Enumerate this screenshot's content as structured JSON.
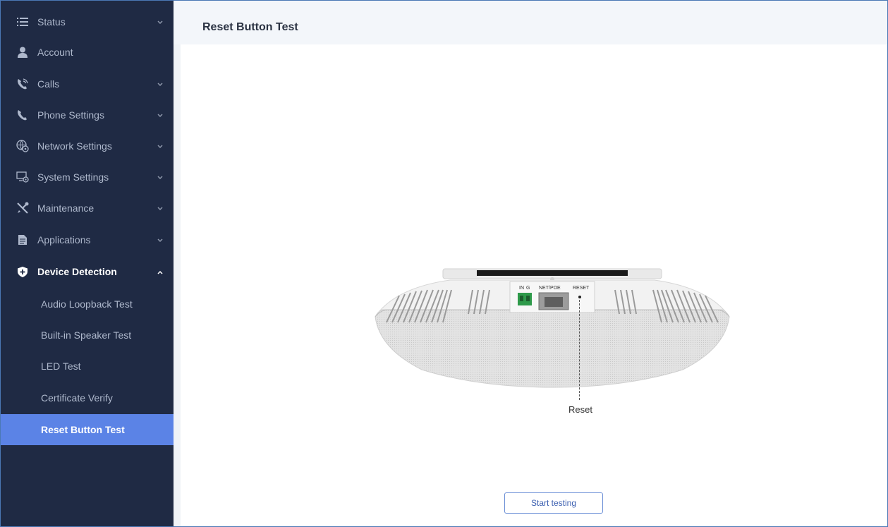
{
  "sidebar": {
    "items": [
      {
        "label": "Status",
        "icon": "list-icon",
        "expandable": true
      },
      {
        "label": "Account",
        "icon": "user-icon",
        "expandable": false
      },
      {
        "label": "Calls",
        "icon": "phone-call-icon",
        "expandable": true
      },
      {
        "label": "Phone Settings",
        "icon": "phone-icon",
        "expandable": true
      },
      {
        "label": "Network Settings",
        "icon": "network-gear-icon",
        "expandable": true
      },
      {
        "label": "System Settings",
        "icon": "monitor-gear-icon",
        "expandable": true
      },
      {
        "label": "Maintenance",
        "icon": "tools-icon",
        "expandable": true
      },
      {
        "label": "Applications",
        "icon": "document-icon",
        "expandable": true
      },
      {
        "label": "Device Detection",
        "icon": "shield-plus-icon",
        "expandable": true,
        "open": true
      }
    ],
    "sub_items": [
      {
        "label": "Audio Loopback Test"
      },
      {
        "label": "Built-in Speaker Test"
      },
      {
        "label": "LED Test"
      },
      {
        "label": "Certificate Verify"
      },
      {
        "label": "Reset Button Test",
        "active": true
      }
    ]
  },
  "page": {
    "title": "Reset Button Test"
  },
  "device": {
    "port_labels": {
      "in": "IN",
      "g": "G",
      "net": "NET/POE",
      "reset": "RESET"
    },
    "callout": "Reset"
  },
  "actions": {
    "start_label": "Start testing"
  },
  "colors": {
    "sidebar_bg": "#1f2a44",
    "active_item_bg": "#5b83e6",
    "button_border": "#6b8fd6"
  }
}
